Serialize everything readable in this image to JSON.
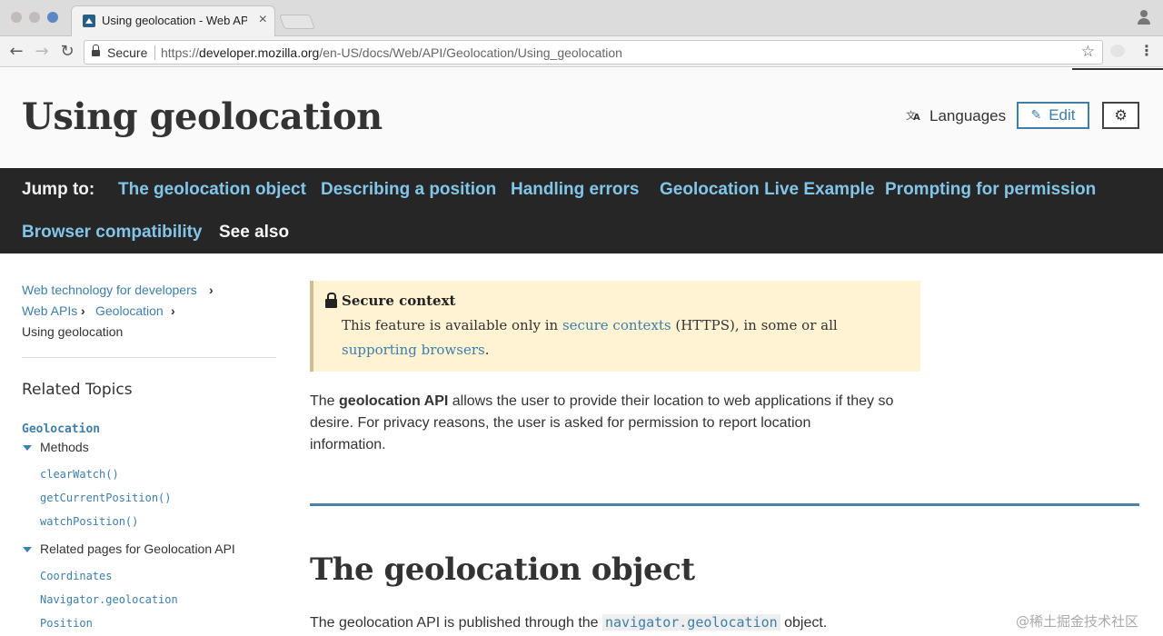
{
  "browser": {
    "tab_title": "Using geolocation - Web APIs",
    "tab_close": "×",
    "secure_label": "Secure",
    "url_scheme": "https://",
    "url_host": "developer.mozilla.org",
    "url_path": "/en-US/docs/Web/API/Geolocation/Using_geolocation",
    "back_glyph": "←",
    "forward_glyph": "→",
    "reload_glyph": "↻",
    "star_glyph": "☆",
    "menu_glyph": "⋮"
  },
  "header": {
    "title": "Using geolocation",
    "languages_label": "Languages",
    "edit_label": "Edit",
    "pencil_glyph": "✎",
    "gear_glyph": "⚙"
  },
  "jumpbar": {
    "label": "Jump to:",
    "links": [
      "The geolocation object",
      "Describing a position",
      "Handling errors",
      "Geolocation Live Example",
      "Prompting for permission",
      "Browser compatibility",
      "See also"
    ]
  },
  "sidebar": {
    "breadcrumbs": [
      "Web technology for developers",
      "Web APIs",
      "Geolocation",
      "Using geolocation"
    ],
    "crumb_sep": "›",
    "related_title": "Related Topics",
    "geolocation_label": "Geolocation",
    "methods_label": "Methods",
    "methods": [
      "clearWatch()",
      "getCurrentPosition()",
      "watchPosition()"
    ],
    "related_pages_label": "Related pages for Geolocation API",
    "related_pages": [
      "Coordinates",
      "Navigator.geolocation",
      "Position"
    ]
  },
  "notice": {
    "title": "Secure context",
    "line1_pre": "This feature is available only in ",
    "line1_link": "secure contexts",
    "line1_post": " (HTTPS), in some or all",
    "line2_link": "supporting browsers",
    "line2_post": "."
  },
  "intro": {
    "pre": "The ",
    "bold": "geolocation API",
    "line1_post": " allows the user to provide their location to web applications if they so",
    "line2": "desire. For privacy reasons, the user is asked for permission to report location",
    "line3": "information."
  },
  "section": {
    "heading": "The geolocation object",
    "para_pre": "The geolocation API is published through the ",
    "para_code": "navigator.geolocation",
    "para_post": " object."
  },
  "watermark": "@稀土掘金技术社区"
}
